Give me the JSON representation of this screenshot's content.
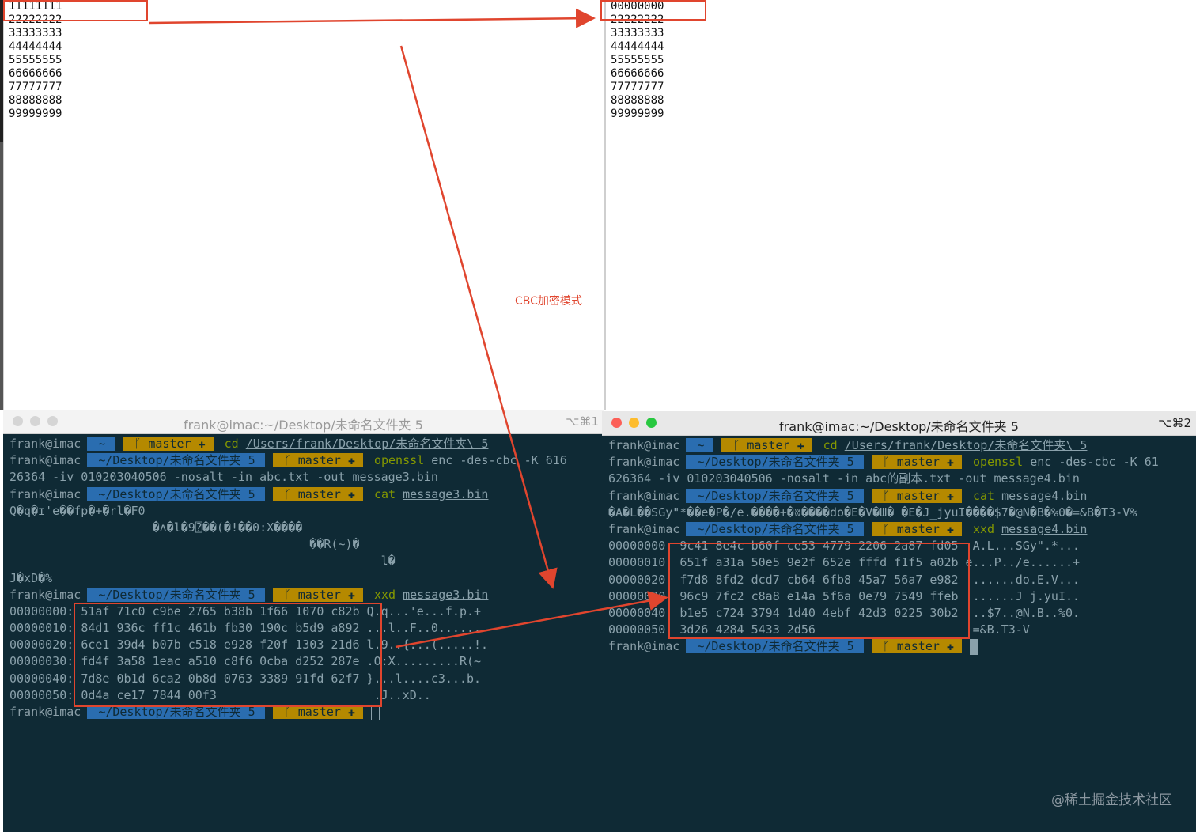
{
  "editor_left": {
    "lines": [
      "11111111",
      "22222222",
      "33333333",
      "44444444",
      "55555555",
      "66666666",
      "77777777",
      "88888888",
      "99999999"
    ]
  },
  "editor_right": {
    "lines": [
      "00000000",
      "22222222",
      "33333333",
      "44444444",
      "55555555",
      "66666666",
      "77777777",
      "88888888",
      "99999999"
    ]
  },
  "annotation": {
    "label": "CBC加密模式",
    "color": "#e0452e"
  },
  "watermark": "@稀土掘金技术社区",
  "term_left": {
    "title": "frank@imac:~/Desktop/未命名文件夹 5",
    "shortcut": "⌥⌘1",
    "prompt_user": "frank@imac",
    "prompt_home": "~",
    "prompt_dir": "~/Desktop/未命名文件夹  5",
    "prompt_git": "master ✚",
    "cmd1": "cd",
    "cmd1_arg": "/Users/frank/Desktop/未命名文件夹\\ 5",
    "cmd2": "openssl",
    "cmd2_args": "enc -des-cbc -K 616",
    "cmd2_wrap": "26364 -iv 010203040506  -nosalt -in abc.txt -out message3.bin",
    "cmd3": "cat",
    "cmd3_file": "message3.bin",
    "garbage": [
      "Q�q�ɪ'e��fp�+�rl�F0",
      "                    �ʌ�l�9⍰��(�!��0:X����",
      "                                          ��R(~)�",
      "                                                    l�",
      "J�xD�%"
    ],
    "cmd4": "xxd",
    "cmd4_file": "message3.bin",
    "hexdump": [
      {
        "addr": "00000000:",
        "bytes": "51af 71c0 c9be 2765 b38b 1f66 1070 c82b",
        "ascii": "Q.q...'e...f.p.+"
      },
      {
        "addr": "00000010:",
        "bytes": "84d1 936c ff1c 461b fb30 190c b5d9 a892",
        "ascii": "...l..F..0......"
      },
      {
        "addr": "00000020:",
        "bytes": "6ce1 39d4 b07b c518 e928 f20f 1303 21d6",
        "ascii": "l.9..{...(.....!."
      },
      {
        "addr": "00000030:",
        "bytes": "fd4f 3a58 1eac a510 c8f6 0cba d252 287e",
        "ascii": ".O:X.........R(~"
      },
      {
        "addr": "00000040:",
        "bytes": "7d8e 0b1d 6ca2 0b8d 0763 3389 91fd 62f7",
        "ascii": "}...l....c3...b."
      },
      {
        "addr": "00000050:",
        "bytes": "0d4a ce17 7844 00f3",
        "ascii": ".J..xD.."
      }
    ]
  },
  "term_right": {
    "title": "frank@imac:~/Desktop/未命名文件夹 5",
    "shortcut": "⌥⌘2",
    "prompt_user": "frank@imac",
    "prompt_home": "~",
    "prompt_dir": "~/Desktop/未命名文件夹  5",
    "prompt_git": "master ✚",
    "cmd1": "cd",
    "cmd1_arg": "/Users/frank/Desktop/未命名文件夹\\ 5",
    "cmd2": "openssl",
    "cmd2_args": "enc -des-cbc -K 61",
    "cmd2_wrap": "626364 -iv 010203040506  -nosalt -in abc的副本.txt -out message4.bin",
    "cmd3": "cat",
    "cmd3_file": "message4.bin",
    "garbage": [
      "�A�L��SGy\"*��e�P�/e.����+�ʬ����do�E�V�Ш� �E�J_jyuI����$7�@N�B�%0�=&B�T3-V%"
    ],
    "cmd4": "xxd",
    "cmd4_file": "message4.bin",
    "hexdump": [
      {
        "addr": "00000000:",
        "bytes": "9c41 8e4c b60f ce53 4779 2206 2a87 fd05",
        "ascii": ".A.L...SGy\".*..."
      },
      {
        "addr": "00000010:",
        "bytes": "651f a31a 50e5 9e2f 652e fffd f1f5 a02b",
        "ascii": "e...P../e......+"
      },
      {
        "addr": "00000020:",
        "bytes": "f7d8 8fd2 dcd7 cb64 6fb8 45a7 56a7 e982",
        "ascii": ".......do.E.V..."
      },
      {
        "addr": "00000030:",
        "bytes": "96c9 7fc2 c8a8 e14a 5f6a 0e79 7549 ffeb",
        "ascii": ".......J_j.yuI.."
      },
      {
        "addr": "00000040:",
        "bytes": "b1e5 c724 3794 1d40 4ebf 42d3 0225 30b2",
        "ascii": "...$7..@N.B..%0."
      },
      {
        "addr": "00000050:",
        "bytes": "3d26 4284 5433 2d56",
        "ascii": "=&B.T3-V"
      }
    ]
  }
}
